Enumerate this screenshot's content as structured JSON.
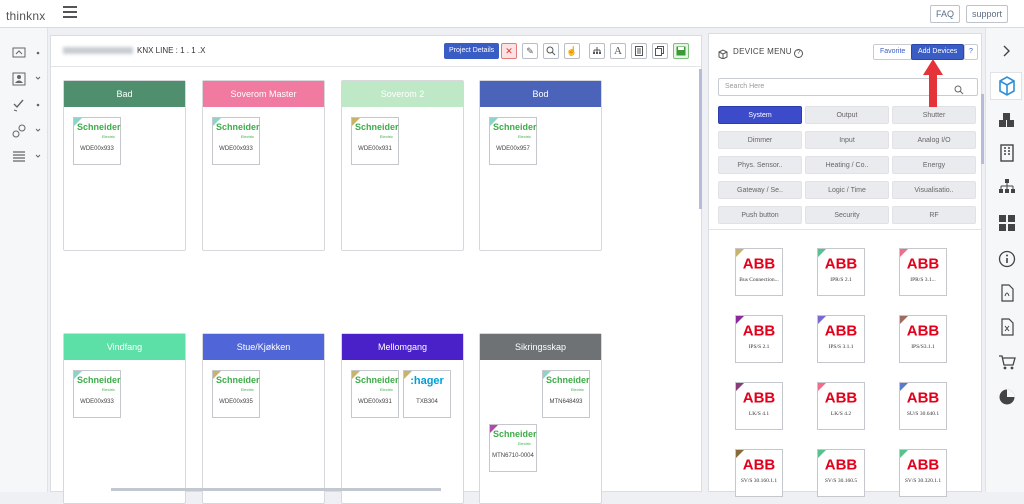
{
  "app": {
    "logo": "thinknx",
    "faq": "FAQ",
    "support": "support"
  },
  "main": {
    "breadcrumb": "KNX LINE : 1 . 1 .X",
    "project_details": "Project Details",
    "rooms": [
      {
        "name": "Bad",
        "color": "#4f8f6e",
        "devices": [
          {
            "brand": "Schneider",
            "label": "WDE00x933",
            "corner": "#8fd3c8"
          }
        ]
      },
      {
        "name": "Soverom Master",
        "color": "#f07aa0",
        "devices": [
          {
            "brand": "Schneider",
            "label": "WDE00x933",
            "corner": "#8fd3c8"
          }
        ]
      },
      {
        "name": "Soverom 2",
        "color": "#bfe8c6",
        "devices": [
          {
            "brand": "Schneider",
            "label": "WDE00x931",
            "corner": "#c9b36b"
          }
        ]
      },
      {
        "name": "Bod",
        "color": "#4b63b8",
        "devices": [
          {
            "brand": "Schneider",
            "label": "WDE00x957",
            "corner": "#8fd3c8"
          }
        ]
      },
      {
        "name": "Vindfang",
        "color": "#5de0a8",
        "devices": [
          {
            "brand": "Schneider",
            "label": "WDE00x933",
            "corner": "#8fd3c8"
          }
        ]
      },
      {
        "name": "Stue/Kjøkken",
        "color": "#5066d8",
        "devices": [
          {
            "brand": "Schneider",
            "label": "WDE00x935",
            "corner": "#c9b36b"
          }
        ]
      },
      {
        "name": "Mellomgang",
        "color": "#4a20c8",
        "devices": [
          {
            "brand": "Schneider",
            "label": "WDE00x931",
            "corner": "#c9b36b"
          },
          {
            "brand": "hager",
            "label": "TXB304",
            "corner": "#c9b36b"
          }
        ]
      },
      {
        "name": "Sikringsskap",
        "color": "#6e7275",
        "devices": [
          {
            "brand": "Schneider",
            "label": "MTN648493",
            "corner": "#8fd3c8"
          },
          {
            "brand": "Schneider",
            "label": "MTN6710-0004",
            "corner": "#b04aa8"
          }
        ]
      }
    ]
  },
  "device_menu": {
    "title": "DEVICE MENU",
    "favorite": "Favorite",
    "add_devices": "Add Devices",
    "help": "?",
    "search_placeholder": "Search Here",
    "categories": [
      "System",
      "Output",
      "Shutter",
      "Dimmer",
      "Input",
      "Analog I/O",
      "Phys. Sensor..",
      "Heating / Co..",
      "Energy",
      "Gateway / Se..",
      "Logic / Time",
      "Visualisatio..",
      "Push button",
      "Security",
      "RF"
    ],
    "selected_category": "System",
    "devices": [
      {
        "brand": "ABB",
        "label": "Bus Connection...",
        "corner": "#c9b36b"
      },
      {
        "brand": "ABB",
        "label": "IPR/S 2.1",
        "corner": "#5ac18e"
      },
      {
        "brand": "ABB",
        "label": "IPR/S 3.1...",
        "corner": "#f06c8c"
      },
      {
        "brand": "ABB",
        "label": "IPS/S 2.1",
        "corner": "#8a2a9a"
      },
      {
        "brand": "ABB",
        "label": "IPS/S 3.1.1",
        "corner": "#7a6acf"
      },
      {
        "brand": "ABB",
        "label": "IPS/S3.1.1",
        "corner": "#a06a60"
      },
      {
        "brand": "ABB",
        "label": "LK/S 4.1",
        "corner": "#8a3a78"
      },
      {
        "brand": "ABB",
        "label": "LK/S 4.2",
        "corner": "#f06c8c"
      },
      {
        "brand": "ABB",
        "label": "SU/S 30.640.1",
        "corner": "#5a7acf"
      },
      {
        "brand": "ABB",
        "label": "SV/S 30.160.1.1",
        "corner": "#8a6a3a"
      },
      {
        "brand": "ABB",
        "label": "SV/S 30.160.5",
        "corner": "#5ac18e"
      },
      {
        "brand": "ABB",
        "label": "SV/S 30.320.1.1",
        "corner": "#5ac18e"
      }
    ]
  },
  "icons": {
    "left": [
      "dashboard-icon",
      "contact-icon",
      "checklist-icon",
      "connections-icon",
      "list-icon"
    ],
    "right": [
      "chevron-right-icon",
      "cube-icon",
      "cubes-icon",
      "building-icon",
      "hierarchy-icon",
      "grid-icon",
      "info-icon",
      "pdf-icon",
      "excel-icon",
      "cart-icon",
      "pie-chart-icon"
    ]
  }
}
